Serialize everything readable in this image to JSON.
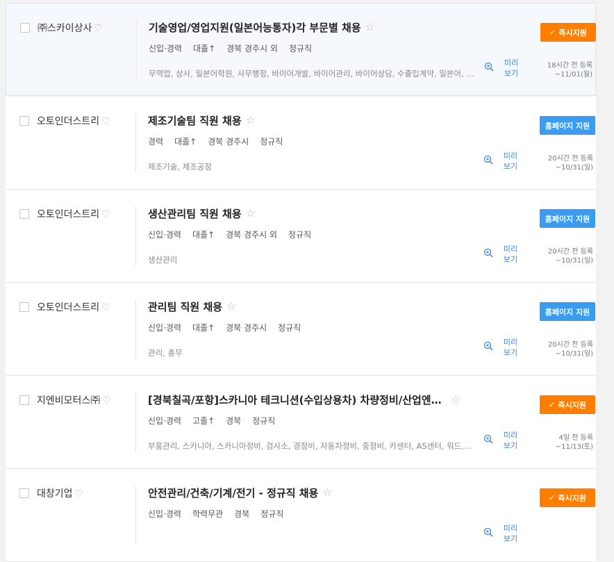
{
  "icons": {
    "favorite": "heart-outline",
    "scrap": "star-outline",
    "preview": "magnifier-plus",
    "apply": "check"
  },
  "colors": {
    "quick_apply": "#ff7e00",
    "homepage_apply": "#3a9bf1",
    "preview_text": "#3b86d8",
    "highlight_bg": "#f5f8fd"
  },
  "jobs": [
    {
      "company": "㈜스카이상사",
      "title": "기술영업/영업지원(일본어능통자)각 부문별 채용",
      "conditions": [
        "신입·경력",
        "대졸↑",
        "경북 경주시 외",
        "정규직"
      ],
      "tags": "무역업, 상사, 일본어학원, 사무행정, 바이어개발, 바이어관리, 바이어상담, 수출입계약, 일본어, 해외영업",
      "preview": "미리보기",
      "button": "즉시지원",
      "posted": "18시간 전 등록",
      "deadline": "~11/01(월)"
    },
    {
      "company": "오토인더스트리",
      "title": "제조기술팀 직원 채용",
      "conditions": [
        "경력",
        "대졸↑",
        "경북 경주시",
        "정규직"
      ],
      "tags": "제조기술, 제조공정",
      "preview": "미리보기",
      "button": "홈페이지 지원",
      "posted": "20시간 전 등록",
      "deadline": "~10/31(일)"
    },
    {
      "company": "오토인더스트리",
      "title": "생산관리팀 직원 채용",
      "conditions": [
        "신입·경력",
        "대졸↑",
        "경북 경주시 외",
        "정규직"
      ],
      "tags": "생산관리",
      "preview": "미리보기",
      "button": "홈페이지 지원",
      "posted": "20시간 전 등록",
      "deadline": "~10/31(일)"
    },
    {
      "company": "오토인더스트리",
      "title": "관리팀 직원 채용",
      "conditions": [
        "신입·경력",
        "대졸↑",
        "경북 경주시",
        "정규직"
      ],
      "tags": "관리, 총무",
      "preview": "미리보기",
      "button": "홈페이지 지원",
      "posted": "20시간 전 등록",
      "deadline": "~10/31(일)"
    },
    {
      "company": "지엔비모터스㈜",
      "title": "[경북칠곡/포항]스카니아 테크니션(수입상용차) 차량정비/산업엔진정비",
      "conditions": [
        "신입·경력",
        "고졸↑",
        "경북",
        "정규직"
      ],
      "tags": "부품관리, 스카니아, 스카니아정비, 검사소, 경정비, 자동차정비, 중정비, 카센터, AS센터, 워드, 전기정비",
      "preview": "미리보기",
      "button": "즉시지원",
      "posted": "4일 전 등록",
      "deadline": "~11/13(토)"
    },
    {
      "company": "대창기업",
      "title": "안전관리/건축/기계/전기 - 정규직 채용",
      "conditions": [
        "신입·경력",
        "학력무관",
        "경북",
        "정규직"
      ],
      "tags": "",
      "preview": "미리보기",
      "button": "즉시지원",
      "posted": "",
      "deadline": ""
    }
  ]
}
